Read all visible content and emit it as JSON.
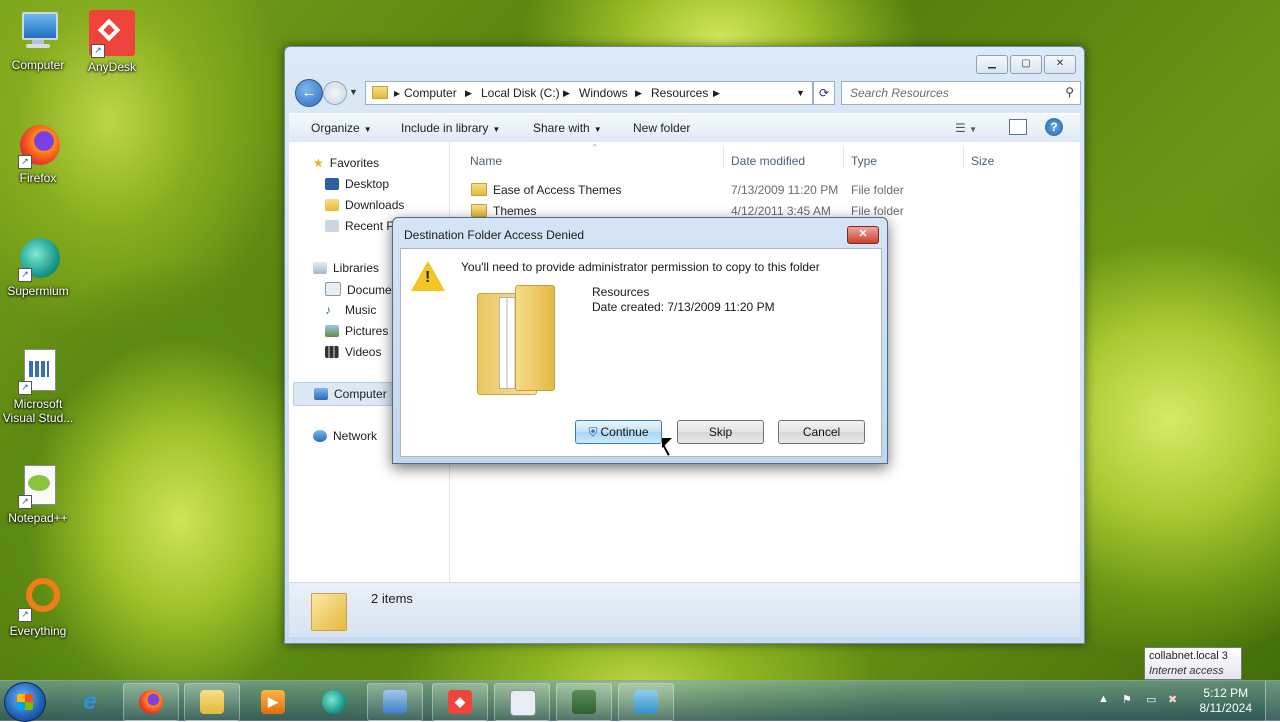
{
  "desktop": {
    "icons": [
      {
        "label": "Computer",
        "icon": "computer-icon"
      },
      {
        "label": "AnyDesk",
        "icon": "anydesk-icon",
        "color": "#ef443b"
      },
      {
        "label": "Firefox",
        "icon": "firefox-icon"
      },
      {
        "label": "Supermium",
        "icon": "supermium-icon"
      },
      {
        "label": "Microsoft Visual Stud...",
        "icon": "visual-studio-icon"
      },
      {
        "label": "Notepad++",
        "icon": "notepadpp-icon"
      },
      {
        "label": "Everything",
        "icon": "everything-icon"
      }
    ]
  },
  "explorer": {
    "breadcrumb": [
      "Computer",
      "Local Disk (C:)",
      "Windows",
      "Resources"
    ],
    "search_placeholder": "Search Resources",
    "toolbar": {
      "organize": "Organize",
      "include_in_library": "Include in library",
      "share_with": "Share with",
      "new_folder": "New folder"
    },
    "nav": {
      "favorites": "Favorites",
      "desktop": "Desktop",
      "downloads": "Downloads",
      "recent_places": "Recent Pl",
      "libraries": "Libraries",
      "documents": "Documer",
      "music": "Music",
      "pictures": "Pictures",
      "videos": "Videos",
      "computer": "Computer",
      "network": "Network"
    },
    "columns": {
      "name": "Name",
      "date_modified": "Date modified",
      "type": "Type",
      "size": "Size"
    },
    "files": [
      {
        "name": "Ease of Access Themes",
        "date": "7/13/2009 11:20 PM",
        "type": "File folder"
      },
      {
        "name": "Themes",
        "date": "4/12/2011 3:45 AM",
        "type": "File folder"
      }
    ],
    "status": "2 items"
  },
  "dialog": {
    "title": "Destination Folder Access Denied",
    "message": "You'll need to provide administrator permission to copy to this folder",
    "folder_name": "Resources",
    "date_created": "Date created: 7/13/2009 11:20 PM",
    "buttons": {
      "continue": "Continue",
      "skip": "Skip",
      "cancel": "Cancel"
    }
  },
  "taskbar": {
    "clock_time": "5:12 PM",
    "clock_date": "8/11/2024"
  },
  "network_tooltip": {
    "line1": "collabnet.local  3",
    "line2": "Internet access"
  }
}
